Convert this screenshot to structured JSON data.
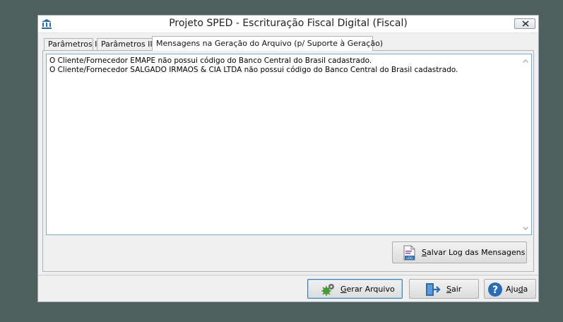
{
  "window": {
    "title": "Projeto SPED - Escrituração Fiscal Digital (Fiscal)"
  },
  "tabs": [
    {
      "label": "Parâmetros I"
    },
    {
      "label": "Parâmetros II"
    },
    {
      "label": "Mensagens na Geração do Arquivo (p/ Suporte à Geração)"
    }
  ],
  "messages": [
    "O Cliente/Fornecedor EMAPE não possui código do Banco Central do Brasil cadastrado.",
    "O Cliente/Fornecedor SALGADO IRMAOS & CIA LTDA não possui código do Banco Central do Brasil cadastrado."
  ],
  "buttons": {
    "save_log": {
      "mnemonic": "S",
      "rest": "alvar Log das Mensagens"
    },
    "generate": {
      "mnemonic": "G",
      "rest": "erar Arquivo"
    },
    "exit": {
      "mnemonic": "S",
      "rest": "air"
    },
    "help": {
      "pre": "Aju",
      "mnemonic": "d",
      "rest": "a"
    }
  },
  "icons": {
    "app": "building-columns-icon",
    "close": "close-icon",
    "save_log": "log-file-icon",
    "generate": "gears-icon",
    "exit": "exit-door-icon",
    "help": "help-icon"
  },
  "colors": {
    "desktop": "#4e5f5d",
    "window": "#f0f0f0",
    "accent": "#2b6cb0"
  }
}
